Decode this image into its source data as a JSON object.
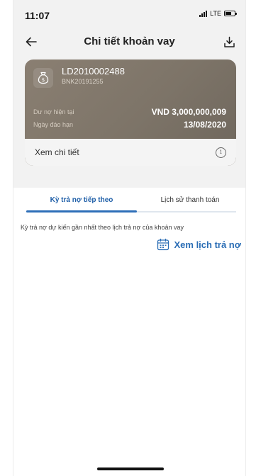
{
  "status_bar": {
    "time": "11:07",
    "network": "LTE"
  },
  "header": {
    "title": "Chi tiết khoản vay"
  },
  "loan": {
    "code": "LD2010002488",
    "contract": "BNK20191255",
    "rows": [
      {
        "label": "Dư nợ hiện tại",
        "value": "VND 3,000,000,009"
      },
      {
        "label": "Ngày đáo hạn",
        "value": "13/08/2020"
      }
    ],
    "detail_link": "Xem chi tiết"
  },
  "tabs": [
    {
      "label": "Kỳ trả nợ tiếp theo",
      "active": true
    },
    {
      "label": "Lịch sử thanh toán",
      "active": false
    }
  ],
  "content": {
    "description": "Kỳ trả nợ dự kiến gần nhất theo lịch trả nợ của khoản vay",
    "schedule_link": "Xem lịch trả nợ"
  },
  "colors": {
    "accent": "#2a6db5",
    "card": "#7d7468"
  },
  "icons": {
    "back": "arrow-left-icon",
    "download": "download-icon",
    "money_bag": "money-bag-icon",
    "info": "info-icon",
    "calendar": "calendar-icon"
  }
}
